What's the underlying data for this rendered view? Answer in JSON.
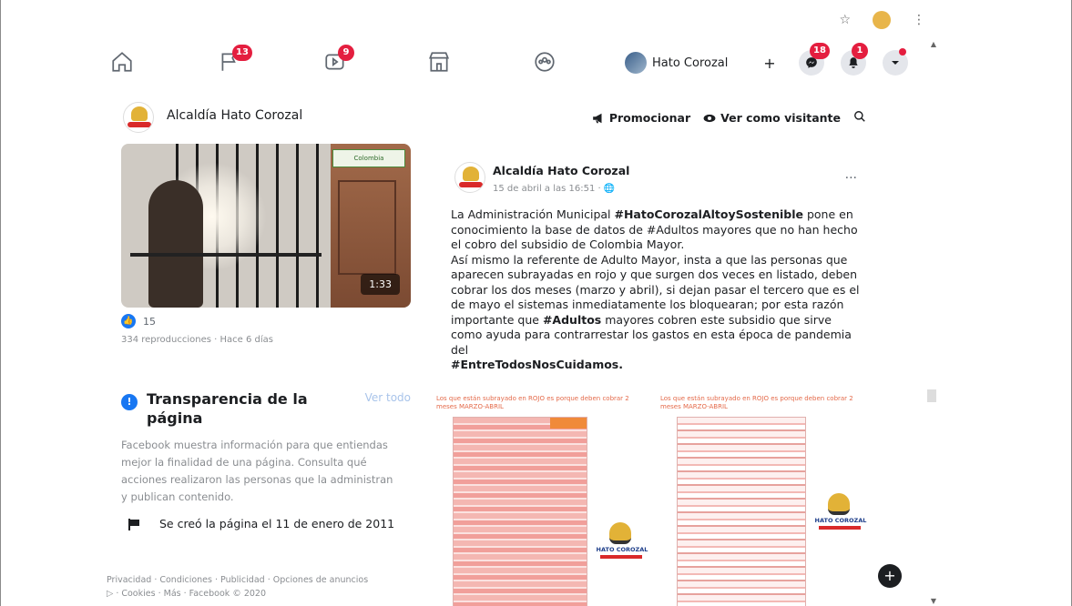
{
  "browser": {
    "star_icon": "☆",
    "menu_icon": "⋮"
  },
  "nav": {
    "home_icon": "home-icon",
    "flag_badge": "13",
    "video_badge": "9",
    "profile_name": "Hato Corozal",
    "plus_label": "+",
    "messenger_badge": "18",
    "bell_badge": "1"
  },
  "page_header": {
    "name": "Alcaldía Hato Corozal",
    "promote_label": "Promocionar",
    "view_as_label": "Ver como visitante"
  },
  "video": {
    "duration": "1:33",
    "overlay_logo_text": "Colombia",
    "reaction_count": "15",
    "plays_text": "334 reproducciones · Hace 6 días"
  },
  "transparency": {
    "title": "Transparencia de la página",
    "see_all": "Ver todo",
    "description": "Facebook muestra información para que entiendas mejor la finalidad de una página. Consulta qué acciones realizaron las personas que la administran y publican contenido.",
    "created": "Se creó la página el 11 de enero de 2011"
  },
  "footer": {
    "links": "Privacidad · Condiciones · Publicidad · Opciones de anuncios",
    "links2": "▷ · Cookies · Más · Facebook © 2020"
  },
  "post": {
    "author": "Alcaldía Hato Corozal",
    "time": "15 de abril a las 16:51 · 🌐",
    "more": "···",
    "p1_a": "La Administración Municipal ",
    "p1_tag": "#HatoCorozalAltoySostenible",
    "p1_b": " pone en conocimiento la base de datos de #Adultos mayores que no han hecho el cobro del subsidio de Colombia Mayor.",
    "p2_a": "Así mismo la referente de Adulto Mayor, insta a que las personas que aparecen subrayadas en rojo y que surgen dos veces en listado, deben cobrar los dos meses (marzo y abril), si dejan pasar el tercero que es el de mayo el sistemas inmediatamente los bloquearan; por esta razón importante que  ",
    "p2_tag": "#Adultos",
    "p2_b": " mayores cobren este subsidio que sirve como ayuda para contrarrestar los gastos en esta época de pandemia del",
    "p3_tag": "#EntreTodosNosCuidamos.",
    "img1_caption": "Los que están subrayado en ROJO es porque deben cobrar 2 meses MARZO-ABRIL",
    "img2_caption": "Los que están subrayado en ROJO es porque deben cobrar 2 meses MARZO-ABRIL",
    "img_logo_text": "HATO COROZAL"
  },
  "fab_label": "+"
}
